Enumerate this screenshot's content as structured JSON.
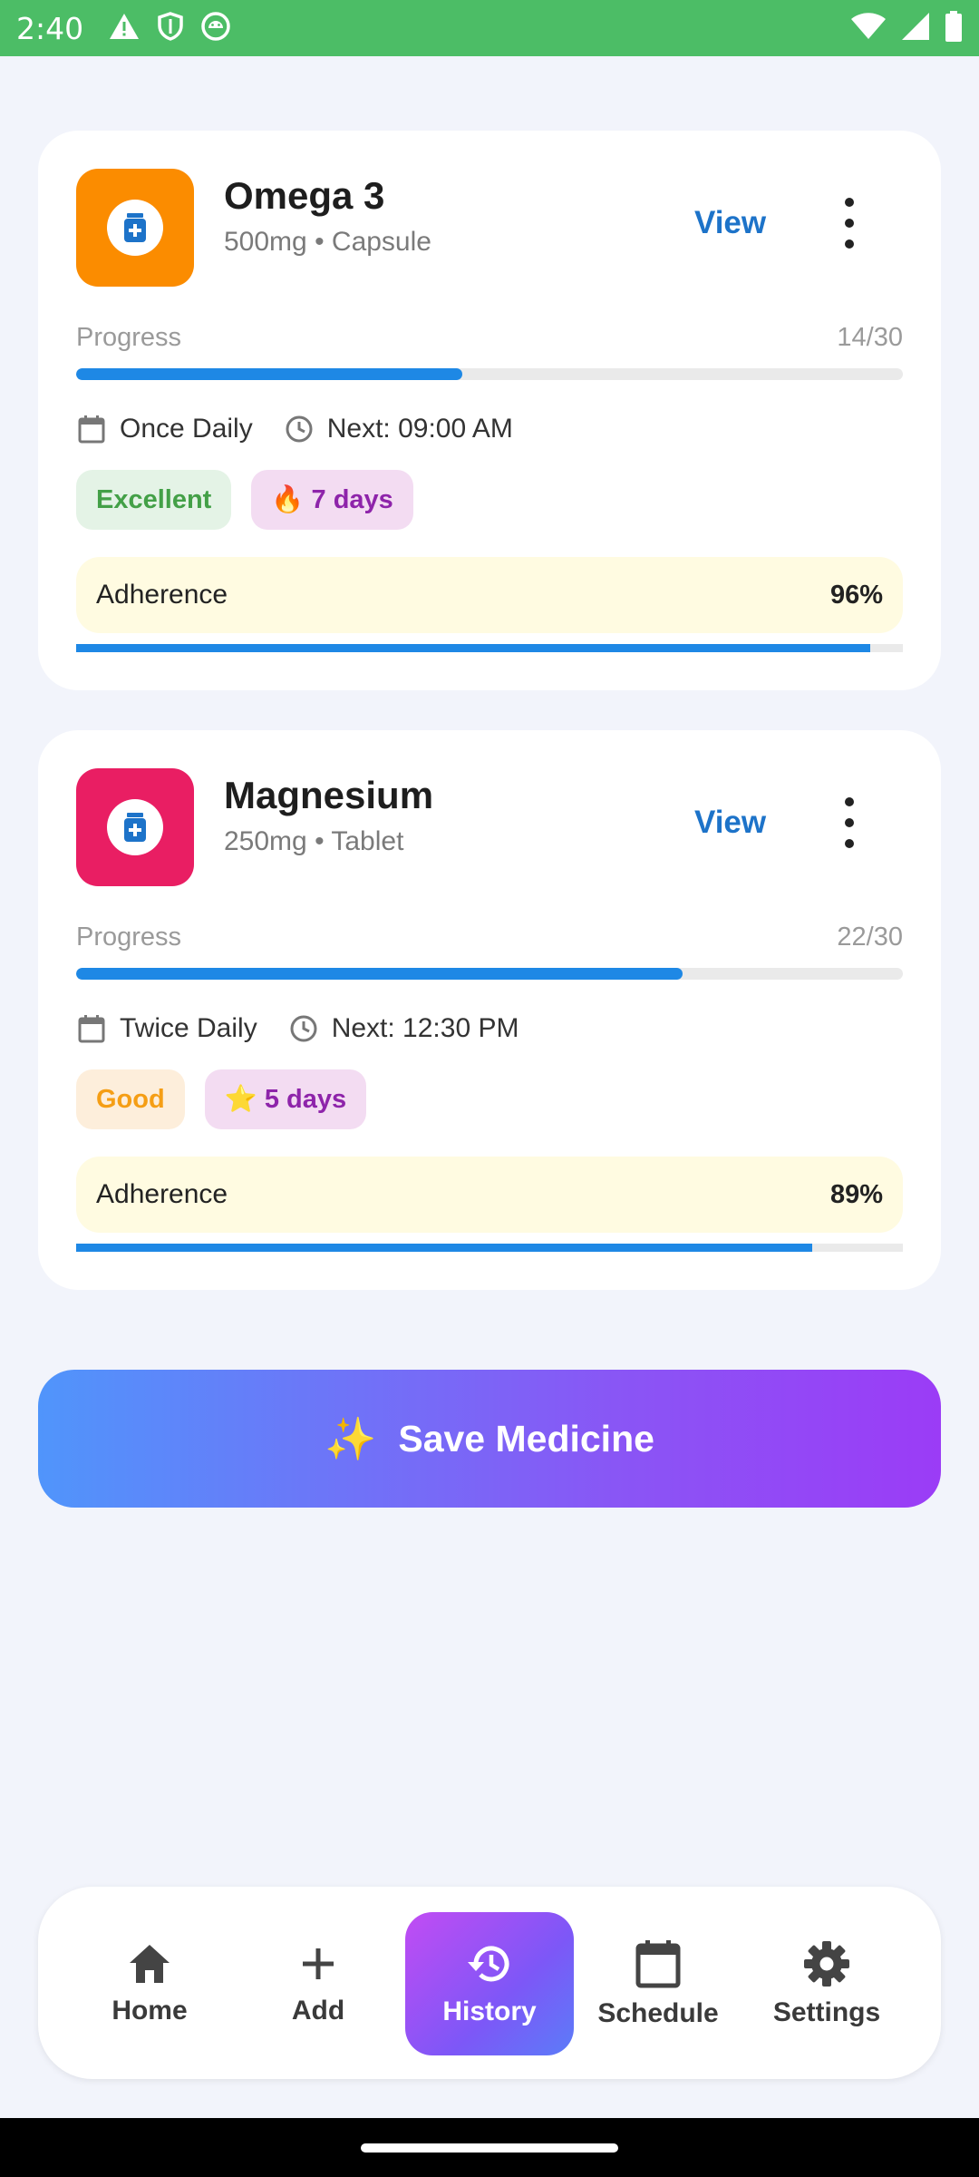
{
  "status_bar": {
    "time": "2:40",
    "icons": [
      "warning-icon",
      "shield-icon",
      "android-icon",
      "wifi-icon",
      "signal-icon",
      "battery-icon"
    ]
  },
  "medicines": [
    {
      "name": "Omega 3",
      "detail": "500mg • Capsule",
      "icon_color": "#fb8c00",
      "icon": "medicine-bottle-icon",
      "view_label": "View",
      "progress_label": "Progress",
      "progress_count": "14/30",
      "progress_fraction": 0.4667,
      "frequency": "Once Daily",
      "next_dose": "Next: 09:00 AM",
      "rating_badge": "Excellent",
      "rating_colors": {
        "bg": "#e4f3e6",
        "fg": "#43a047"
      },
      "streak_badge": "🔥 7 days",
      "streak_colors": {
        "bg": "#f3dcf2",
        "fg": "#8e24aa"
      },
      "adherence_label": "Adherence",
      "adherence_value": "96%",
      "adherence_fraction": 0.96
    },
    {
      "name": "Magnesium",
      "detail": "250mg • Tablet",
      "icon_color": "#e91e63",
      "icon": "medicine-bottle-icon",
      "view_label": "View",
      "progress_label": "Progress",
      "progress_count": "22/30",
      "progress_fraction": 0.7333,
      "frequency": "Twice Daily",
      "next_dose": "Next: 12:30 PM",
      "rating_badge": "Good",
      "rating_colors": {
        "bg": "#fdeedb",
        "fg": "#f59e15"
      },
      "streak_badge": "⭐ 5 days",
      "streak_colors": {
        "bg": "#f3dcf2",
        "fg": "#8e24aa"
      },
      "adherence_label": "Adherence",
      "adherence_value": "89%",
      "adherence_fraction": 0.89
    }
  ],
  "save_button": {
    "icon": "sparkles-icon",
    "sparkle": "✨",
    "label": "Save Medicine"
  },
  "bottom_nav": {
    "active": "History",
    "items": [
      {
        "label": "Home",
        "icon": "home-icon"
      },
      {
        "label": "Add",
        "icon": "plus-icon"
      },
      {
        "label": "History",
        "icon": "history-icon"
      },
      {
        "label": "Schedule",
        "icon": "calendar-icon"
      },
      {
        "label": "Settings",
        "icon": "gear-icon"
      }
    ]
  },
  "colors": {
    "accent_blue": "#1e88e5",
    "link_blue": "#1d73c9",
    "status_bar": "#4cbd66",
    "background": "#f2f4fb"
  }
}
